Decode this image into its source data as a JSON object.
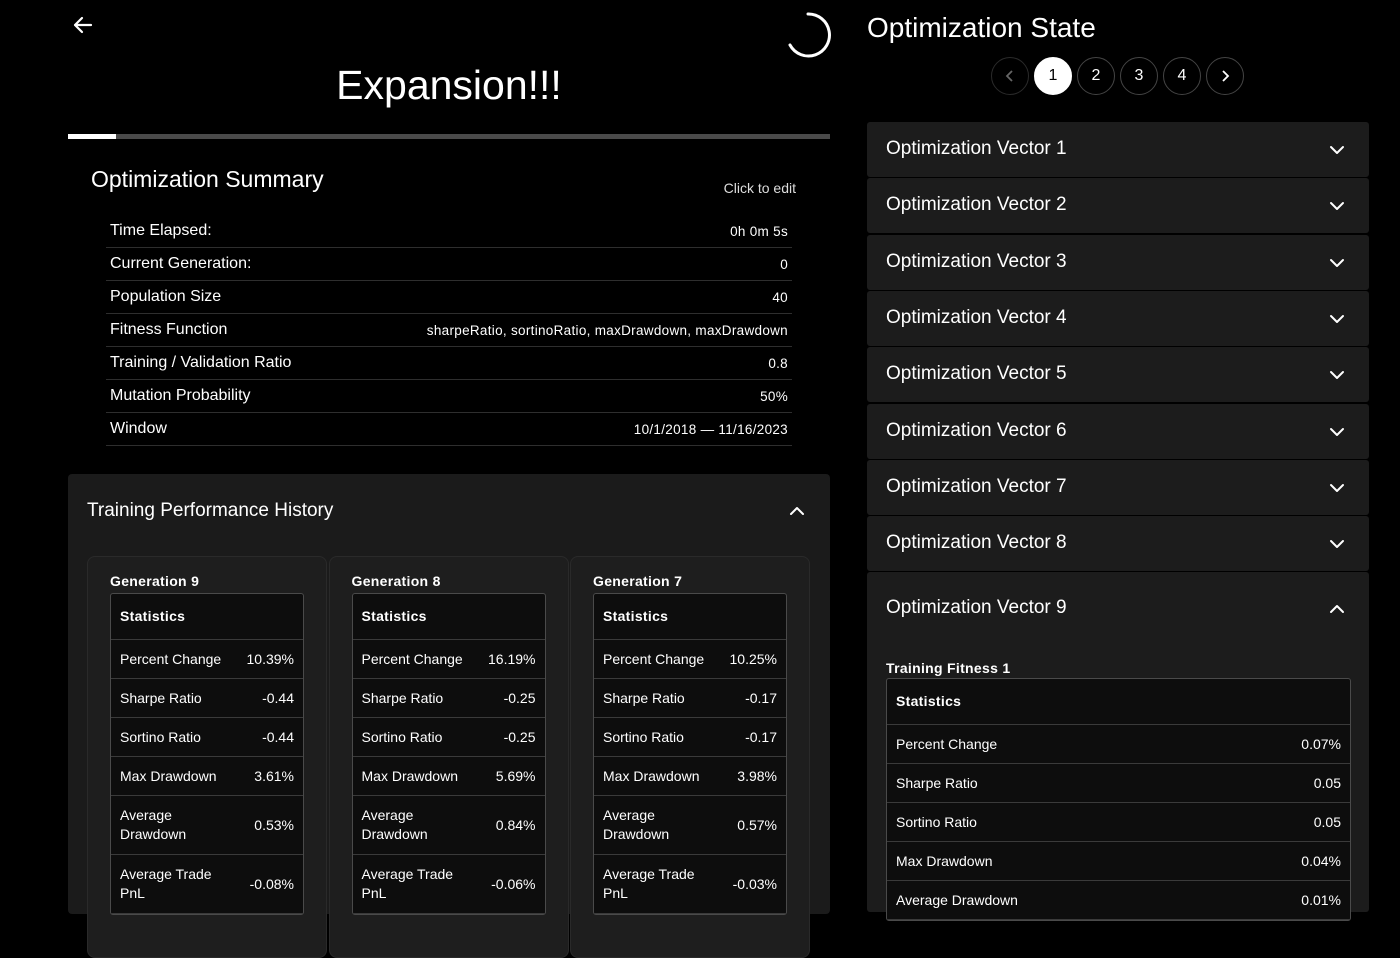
{
  "header": {
    "title": "Expansion!!!",
    "progress_percent": 6.3
  },
  "summary": {
    "title": "Optimization Summary",
    "edit_label": "Click to edit",
    "rows": [
      {
        "label": "Time Elapsed:",
        "value": "0h 0m 5s"
      },
      {
        "label": "Current Generation:",
        "value": "0"
      },
      {
        "label": "Population Size",
        "value": "40"
      },
      {
        "label": "Fitness Function",
        "value": "sharpeRatio, sortinoRatio, maxDrawdown, maxDrawdown"
      },
      {
        "label": "Training / Validation Ratio",
        "value": "0.8"
      },
      {
        "label": "Mutation Probability",
        "value": "50%"
      },
      {
        "label": "Window",
        "value": "10/1/2018 — 11/16/2023"
      }
    ]
  },
  "history": {
    "title": "Training Performance History",
    "stats_header": "Statistics",
    "generations": [
      {
        "title": "Generation 9",
        "stats": [
          {
            "label": "Percent Change",
            "value": "10.39%"
          },
          {
            "label": "Sharpe Ratio",
            "value": "-0.44"
          },
          {
            "label": "Sortino Ratio",
            "value": "-0.44"
          },
          {
            "label": "Max Drawdown",
            "value": "3.61%"
          },
          {
            "label": "Average Drawdown",
            "value": "0.53%"
          },
          {
            "label": "Average Trade PnL",
            "value": "-0.08%"
          }
        ]
      },
      {
        "title": "Generation 8",
        "stats": [
          {
            "label": "Percent Change",
            "value": "16.19%"
          },
          {
            "label": "Sharpe Ratio",
            "value": "-0.25"
          },
          {
            "label": "Sortino Ratio",
            "value": "-0.25"
          },
          {
            "label": "Max Drawdown",
            "value": "5.69%"
          },
          {
            "label": "Average Drawdown",
            "value": "0.84%"
          },
          {
            "label": "Average Trade PnL",
            "value": "-0.06%"
          }
        ]
      },
      {
        "title": "Generation 7",
        "stats": [
          {
            "label": "Percent Change",
            "value": "10.25%"
          },
          {
            "label": "Sharpe Ratio",
            "value": "-0.17"
          },
          {
            "label": "Sortino Ratio",
            "value": "-0.17"
          },
          {
            "label": "Max Drawdown",
            "value": "3.98%"
          },
          {
            "label": "Average Drawdown",
            "value": "0.57%"
          },
          {
            "label": "Average Trade PnL",
            "value": "-0.03%"
          }
        ]
      }
    ]
  },
  "state": {
    "title": "Optimization State",
    "pages": [
      "1",
      "2",
      "3",
      "4"
    ],
    "active_page": "1",
    "vectors": [
      "Optimization Vector 1",
      "Optimization Vector 2",
      "Optimization Vector 3",
      "Optimization Vector 4",
      "Optimization Vector 5",
      "Optimization Vector 6",
      "Optimization Vector 7",
      "Optimization Vector 8"
    ],
    "expanded": {
      "title": "Optimization Vector 9",
      "fitness_title": "Training Fitness 1",
      "stats_header": "Statistics",
      "stats": [
        {
          "label": "Percent Change",
          "value": "0.07%"
        },
        {
          "label": "Sharpe Ratio",
          "value": "0.05"
        },
        {
          "label": "Sortino Ratio",
          "value": "0.05"
        },
        {
          "label": "Max Drawdown",
          "value": "0.04%"
        },
        {
          "label": "Average Drawdown",
          "value": "0.01%"
        }
      ]
    }
  }
}
